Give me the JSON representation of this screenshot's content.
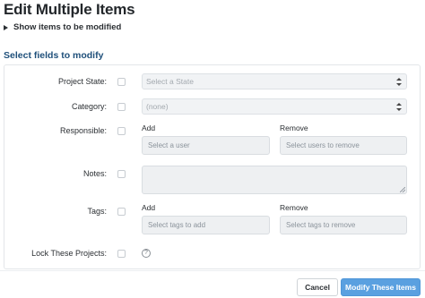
{
  "header": {
    "title": "Edit Multiple Items",
    "show_items_label": "Show items to be modified",
    "section_title": "Select fields to modify"
  },
  "fields": {
    "project_state": {
      "label": "Project State:",
      "placeholder": "Select a State"
    },
    "category": {
      "label": "Category:",
      "value": "(none)"
    },
    "responsible": {
      "label": "Responsible:",
      "add_label": "Add",
      "remove_label": "Remove",
      "add_placeholder": "Select a user",
      "remove_placeholder": "Select users to remove"
    },
    "notes": {
      "label": "Notes:"
    },
    "tags": {
      "label": "Tags:",
      "add_label": "Add",
      "remove_label": "Remove",
      "add_placeholder": "Select tags to add",
      "remove_placeholder": "Select tags to remove"
    },
    "lock_projects": {
      "label": "Lock These Projects:",
      "help_icon": "?"
    }
  },
  "footer": {
    "cancel_label": "Cancel",
    "submit_label": "Modify These Items"
  },
  "colors": {
    "primary_button": "#5aa0e0",
    "section_title": "#1e4f7a",
    "field_background": "#eef0f2"
  }
}
